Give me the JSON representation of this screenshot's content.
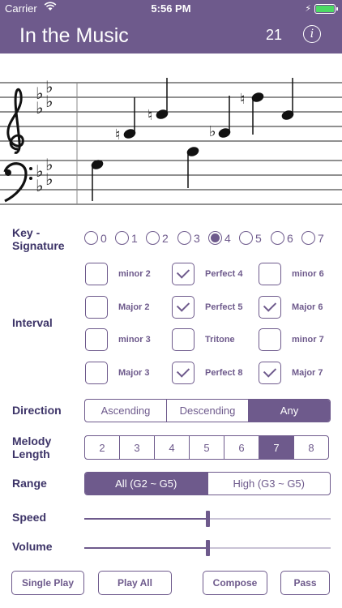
{
  "status": {
    "carrier": "Carrier",
    "time": "5:56 PM"
  },
  "nav": {
    "title": "In the Music",
    "count": "21",
    "info_glyph": "i"
  },
  "labels": {
    "key_signature_line1": "Key -",
    "key_signature_line2": "Signature",
    "interval": "Interval",
    "direction": "Direction",
    "melody_length_line1": "Melody",
    "melody_length_line2": "Length",
    "range": "Range",
    "speed": "Speed",
    "volume": "Volume"
  },
  "key_signature": {
    "options": [
      "0",
      "1",
      "2",
      "3",
      "4",
      "5",
      "6",
      "7"
    ],
    "selected": "4"
  },
  "intervals": [
    {
      "label": "minor 2",
      "checked": false
    },
    {
      "label": "Perfect 4",
      "checked": true
    },
    {
      "label": "minor 6",
      "checked": false
    },
    {
      "label": "Major 2",
      "checked": false
    },
    {
      "label": "Perfect 5",
      "checked": true
    },
    {
      "label": "Major 6",
      "checked": true
    },
    {
      "label": "minor 3",
      "checked": false
    },
    {
      "label": "Tritone",
      "checked": false
    },
    {
      "label": "minor 7",
      "checked": false
    },
    {
      "label": "Major 3",
      "checked": false
    },
    {
      "label": "Perfect 8",
      "checked": true
    },
    {
      "label": "Major 7",
      "checked": true
    }
  ],
  "direction": {
    "options": [
      "Ascending",
      "Descending",
      "Any"
    ],
    "selected": "Any"
  },
  "melody_length": {
    "options": [
      "2",
      "3",
      "4",
      "5",
      "6",
      "7",
      "8"
    ],
    "selected": "7"
  },
  "range": {
    "options": [
      "All (G2 ~ G5)",
      "High (G3 ~ G5)"
    ],
    "selected": "All (G2 ~ G5)"
  },
  "speed": {
    "value": 0.5
  },
  "volume": {
    "value": 0.5
  },
  "buttons": {
    "single_play": "Single Play",
    "play_all": "Play All",
    "compose": "Compose",
    "pass": "Pass"
  },
  "colors": {
    "accent": "#6e5a8c",
    "battery": "#4cd964"
  },
  "icons": {
    "wifi": "wifi-icon",
    "battery": "battery-icon",
    "info": "info-icon",
    "treble": "treble-clef-icon",
    "bass": "bass-clef-icon"
  }
}
